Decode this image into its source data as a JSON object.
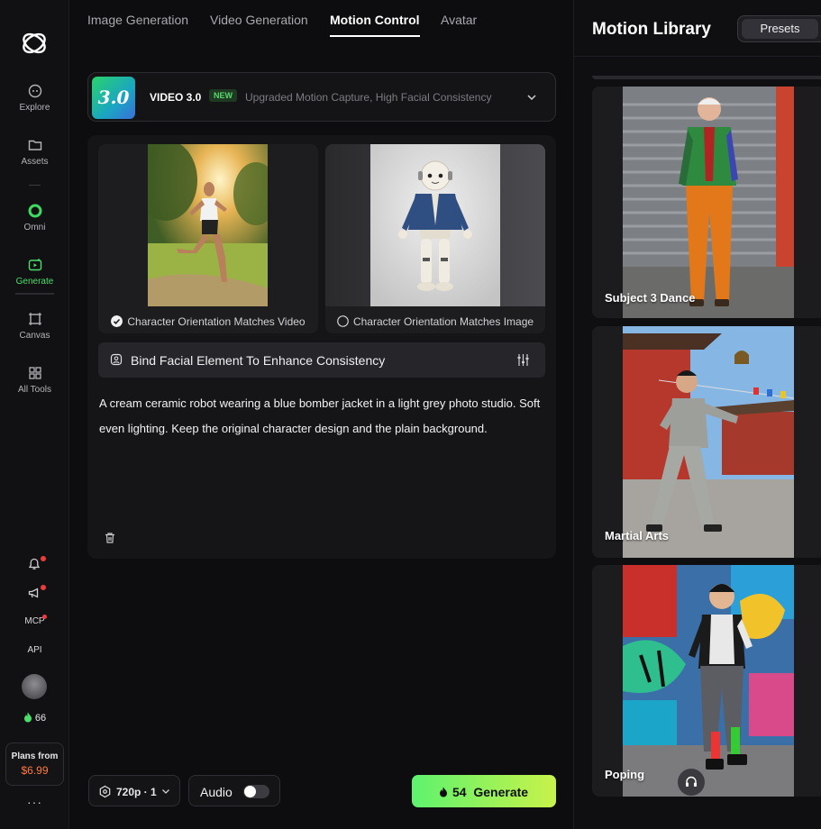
{
  "sidebar": {
    "items": [
      {
        "label": "Explore",
        "icon": "compass-icon"
      },
      {
        "label": "Assets",
        "icon": "folder-icon"
      },
      {
        "label": "Omni",
        "icon": "omni-ring-icon"
      },
      {
        "label": "Generate",
        "icon": "generate-icon",
        "active": true
      },
      {
        "label": "Canvas",
        "icon": "canvas-icon"
      },
      {
        "label": "All Tools",
        "icon": "grid-icon"
      }
    ],
    "mcp_label": "MCP",
    "api_label": "API",
    "credits": "66",
    "plans_title": "Plans from",
    "plans_price": "$6.99",
    "more": "···"
  },
  "tabs": [
    {
      "label": "Image Generation"
    },
    {
      "label": "Video Generation"
    },
    {
      "label": "Motion Control",
      "active": true
    },
    {
      "label": "Avatar"
    }
  ],
  "model": {
    "thumb_text": "3.0",
    "name": "VIDEO 3.0",
    "badge": "NEW",
    "description": "Upgraded Motion Capture, High Facial Consistency"
  },
  "sources": {
    "video_option": "Character Orientation Matches Video",
    "image_option": "Character Orientation Matches Image",
    "video_option_checked": true
  },
  "bind_facial": "Bind Facial Element To Enhance Consistency",
  "prompt": "A cream ceramic robot wearing a blue bomber jacket in a light grey photo studio. Soft even lighting. Keep the original character design and the plain background.",
  "controls": {
    "resolution": "720p · 1",
    "audio_label": "Audio",
    "audio_on": false,
    "generate_cost": "54",
    "generate_label": "Generate"
  },
  "library": {
    "title": "Motion Library",
    "presets_label": "Presets",
    "cards": [
      {
        "name": "Subject 3 Dance"
      },
      {
        "name": "Martial Arts"
      },
      {
        "name": "Poping"
      }
    ]
  },
  "colors": {
    "accent_green": "#4ade6b",
    "generate_gradient_start": "#5ef26e",
    "generate_gradient_end": "#c8f24a",
    "price_orange": "#ff7a3d",
    "notification_red": "#ef3b3b"
  }
}
